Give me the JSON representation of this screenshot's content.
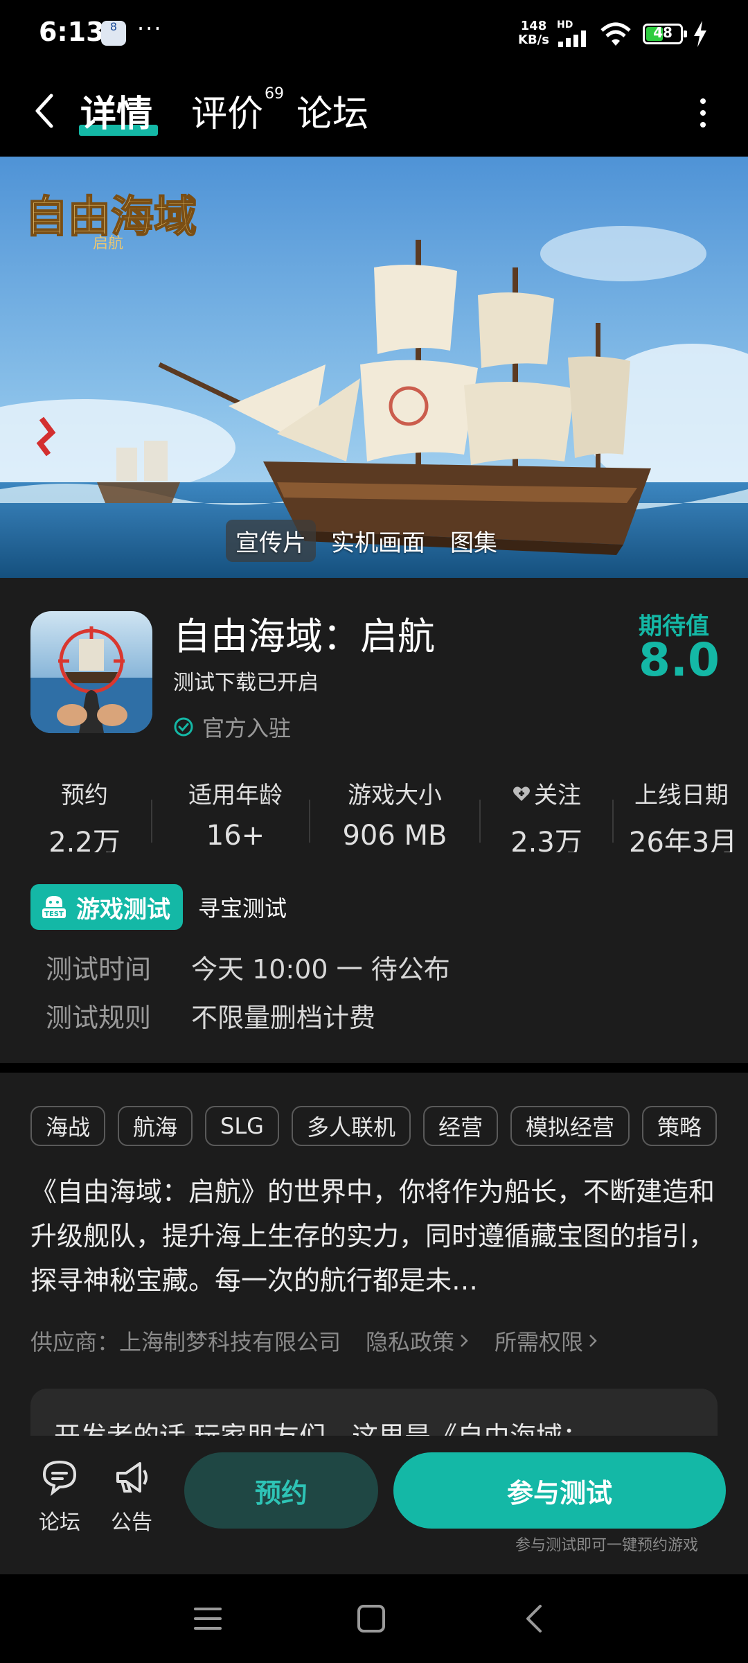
{
  "status_bar": {
    "time": "6:13",
    "app_badge": "8",
    "more_dots": "···",
    "net_speed_value": "148",
    "net_speed_unit": "KB/s",
    "hd_label": "HD",
    "battery_level": "48"
  },
  "nav": {
    "tabs": [
      {
        "label": "详情",
        "active": true
      },
      {
        "label": "评价",
        "badge": "69"
      },
      {
        "label": "论坛"
      }
    ]
  },
  "banner": {
    "logo_text": "自由海域",
    "logo_sub": "启航",
    "media_tabs": [
      {
        "label": "宣传片",
        "active": true
      },
      {
        "label": "实机画面"
      },
      {
        "label": "图集"
      }
    ]
  },
  "game": {
    "title": "自由海域：启航",
    "subtitle": "测试下载已开启",
    "official": "官方入驻",
    "expect_label": "期待值",
    "expect_value": "8.0"
  },
  "stats": [
    {
      "label": "预约",
      "value": "2.2万"
    },
    {
      "label": "适用年龄",
      "value": "16+"
    },
    {
      "label": "游戏大小",
      "value": "906 MB"
    },
    {
      "label": "关注",
      "value": "2.3万",
      "icon": "heart-plus-icon"
    },
    {
      "label": "上线日期",
      "value": "26年3月"
    }
  ],
  "test": {
    "tabs": [
      {
        "label": "游戏测试",
        "active": true,
        "icon": "test-badge-icon"
      },
      {
        "label": "寻宝测试"
      }
    ],
    "rows": [
      {
        "key": "测试时间",
        "value": "今天 10:00 一 待公布"
      },
      {
        "key": "测试规则",
        "value": "不限量删档计费"
      }
    ]
  },
  "tags": [
    "海战",
    "航海",
    "SLG",
    "多人联机",
    "经营",
    "模拟经营",
    "策略"
  ],
  "description": "《自由海域：启航》的世界中，你将作为船长，不断建造和升级舰队，提升海上生存的实力，同时遵循藏宝图的指引，探寻神秘宝藏。每一次的航行都是未…",
  "supplier": {
    "text": "供应商：上海制梦科技有限公司",
    "privacy": "隐私政策",
    "permissions": "所需权限"
  },
  "dev_note": "开发者的话  玩家朋友们，这里是《自由海域：",
  "actions": {
    "forum": "论坛",
    "notice": "公告",
    "reserve": "预约",
    "join": "参与测试",
    "join_hint": "参与测试即可一键预约游戏"
  },
  "colors": {
    "accent": "#14b8a6",
    "background": "#1c1c1c",
    "reserve_bg": "#1f4744"
  }
}
